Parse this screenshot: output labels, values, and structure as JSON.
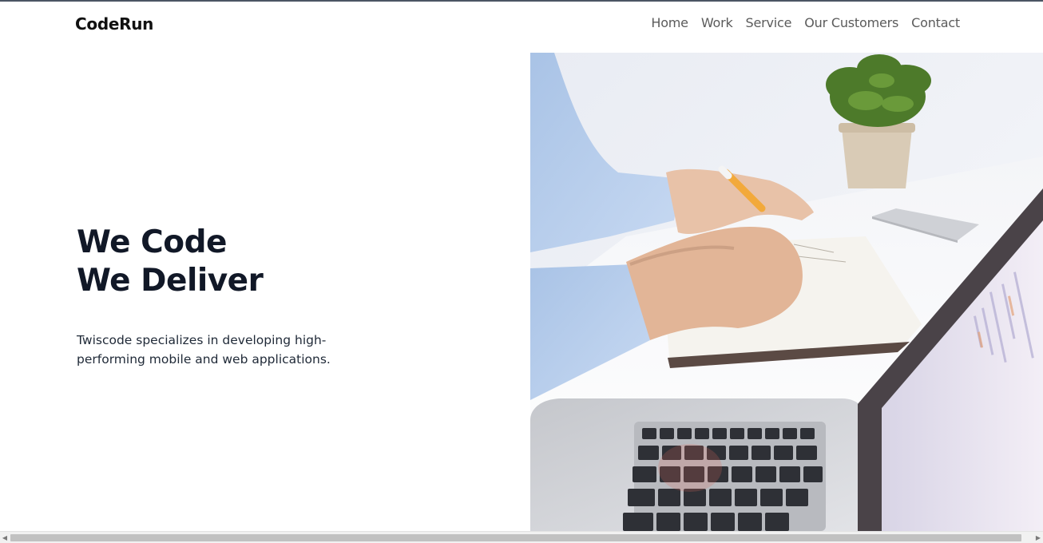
{
  "brand": "CodeRun",
  "nav": {
    "items": [
      "Home",
      "Work",
      "Service",
      "Our Customers",
      "Contact"
    ]
  },
  "hero": {
    "title_line1": "We Code",
    "title_line2": "We Deliver",
    "description": "Twiscode specializes in developing high-performing mobile and web applications."
  },
  "image": {
    "subject": "workspace-photo",
    "alt": "Person writing in a notebook next to a laptop and a potted plant"
  },
  "scrollbar": {
    "left_arrow": "◀",
    "right_arrow": "▶"
  },
  "colors": {
    "heading": "#111827",
    "nav_text": "#5b5b5b",
    "brand": "#111111"
  }
}
